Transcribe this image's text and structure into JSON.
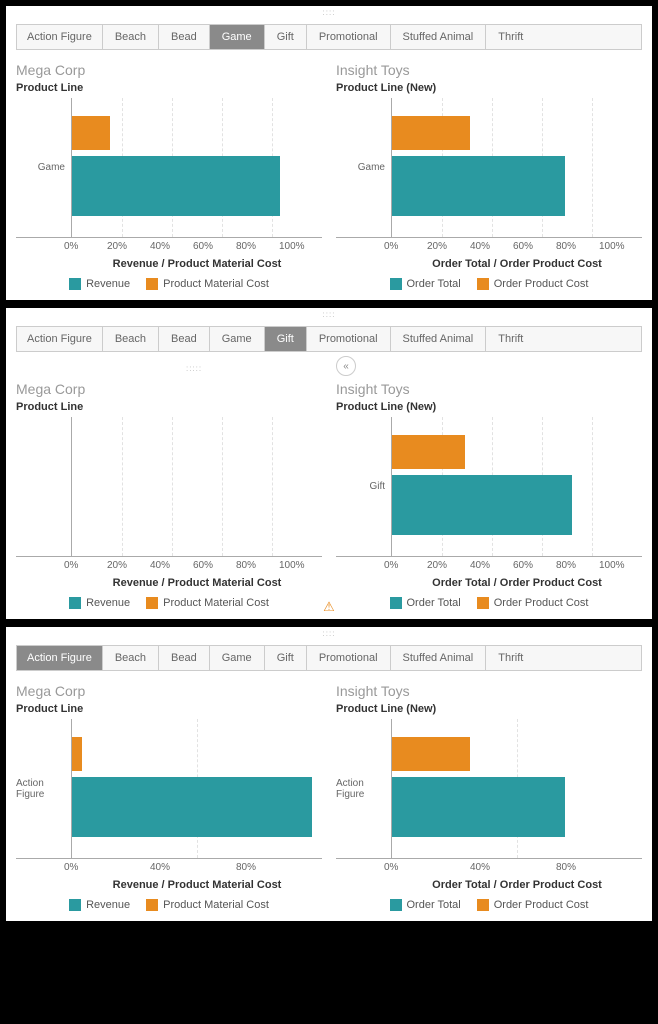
{
  "colors": {
    "teal": "#2a9aa0",
    "orange": "#e88b1f"
  },
  "tabs": [
    "Action Figure",
    "Beach",
    "Bead",
    "Game",
    "Gift",
    "Promotional",
    "Stuffed Animal",
    "Thrift"
  ],
  "panels": [
    {
      "active_tab": "Game",
      "show_widget_handle": false,
      "show_collapse": false,
      "show_warning": false,
      "left": {
        "company": "Mega Corp",
        "y_axis_title": "Product Line",
        "category": "Game",
        "x_axis_title": "Revenue / Product Material Cost",
        "ticks": [
          "0%",
          "20%",
          "40%",
          "60%",
          "80%",
          "100%"
        ],
        "legend": [
          "Revenue",
          "Product Material Cost"
        ],
        "bar_orange_pct": 15,
        "bar_teal_pct": 83
      },
      "right": {
        "company": "Insight Toys",
        "y_axis_title": "Product Line (New)",
        "category": "Game",
        "x_axis_title": "Order Total / Order Product Cost",
        "ticks": [
          "0%",
          "20%",
          "40%",
          "60%",
          "80%",
          "100%"
        ],
        "legend": [
          "Order Total",
          "Order Product Cost"
        ],
        "bar_orange_pct": 31,
        "bar_teal_pct": 69
      }
    },
    {
      "active_tab": "Gift",
      "show_widget_handle": true,
      "show_collapse": true,
      "show_warning": true,
      "left": {
        "company": "Mega Corp",
        "y_axis_title": "Product Line",
        "category": "",
        "x_axis_title": "Revenue / Product Material Cost",
        "ticks": [
          "0%",
          "20%",
          "40%",
          "60%",
          "80%",
          "100%"
        ],
        "legend": [
          "Revenue",
          "Product Material Cost"
        ],
        "bar_orange_pct": 0,
        "bar_teal_pct": 0
      },
      "right": {
        "company": "Insight Toys",
        "y_axis_title": "Product Line (New)",
        "category": "Gift",
        "x_axis_title": "Order Total / Order Product Cost",
        "ticks": [
          "0%",
          "20%",
          "40%",
          "60%",
          "80%",
          "100%"
        ],
        "legend": [
          "Order Total",
          "Order Product Cost"
        ],
        "bar_orange_pct": 29,
        "bar_teal_pct": 72
      }
    },
    {
      "active_tab": "Action Figure",
      "show_widget_handle": false,
      "show_collapse": false,
      "show_warning": false,
      "left": {
        "company": "Mega Corp",
        "y_axis_title": "Product Line",
        "category": "Action Figure",
        "x_axis_title": "Revenue / Product Material Cost",
        "ticks": [
          "0%",
          "40%",
          "80%"
        ],
        "legend": [
          "Revenue",
          "Product Material Cost"
        ],
        "bar_orange_pct": 4,
        "bar_teal_pct": 96
      },
      "right": {
        "company": "Insight Toys",
        "y_axis_title": "Product Line (New)",
        "category": "Action Figure",
        "x_axis_title": "Order Total / Order Product Cost",
        "ticks": [
          "0%",
          "40%",
          "80%"
        ],
        "legend": [
          "Order Total",
          "Order Product Cost"
        ],
        "bar_orange_pct": 31,
        "bar_teal_pct": 69
      }
    }
  ],
  "chart_data": [
    {
      "panel": 0,
      "side": "left",
      "type": "bar",
      "orientation": "horizontal",
      "title": "Mega Corp",
      "ylabel": "Product Line",
      "xlabel": "Revenue / Product Material Cost",
      "xlim": [
        0,
        100
      ],
      "x_unit": "%",
      "categories": [
        "Game"
      ],
      "series": [
        {
          "name": "Product Material Cost",
          "values": [
            15
          ],
          "color": "#e88b1f"
        },
        {
          "name": "Revenue",
          "values": [
            83
          ],
          "color": "#2a9aa0"
        }
      ]
    },
    {
      "panel": 0,
      "side": "right",
      "type": "bar",
      "orientation": "horizontal",
      "title": "Insight Toys",
      "ylabel": "Product Line (New)",
      "xlabel": "Order Total / Order Product Cost",
      "xlim": [
        0,
        100
      ],
      "x_unit": "%",
      "categories": [
        "Game"
      ],
      "series": [
        {
          "name": "Order Product Cost",
          "values": [
            31
          ],
          "color": "#e88b1f"
        },
        {
          "name": "Order Total",
          "values": [
            69
          ],
          "color": "#2a9aa0"
        }
      ]
    },
    {
      "panel": 1,
      "side": "left",
      "type": "bar",
      "orientation": "horizontal",
      "title": "Mega Corp",
      "ylabel": "Product Line",
      "xlabel": "Revenue / Product Material Cost",
      "xlim": [
        0,
        100
      ],
      "x_unit": "%",
      "categories": [],
      "series": [
        {
          "name": "Product Material Cost",
          "values": [],
          "color": "#e88b1f"
        },
        {
          "name": "Revenue",
          "values": [],
          "color": "#2a9aa0"
        }
      ],
      "note": "no data for Gift in Mega Corp"
    },
    {
      "panel": 1,
      "side": "right",
      "type": "bar",
      "orientation": "horizontal",
      "title": "Insight Toys",
      "ylabel": "Product Line (New)",
      "xlabel": "Order Total / Order Product Cost",
      "xlim": [
        0,
        100
      ],
      "x_unit": "%",
      "categories": [
        "Gift"
      ],
      "series": [
        {
          "name": "Order Product Cost",
          "values": [
            29
          ],
          "color": "#e88b1f"
        },
        {
          "name": "Order Total",
          "values": [
            72
          ],
          "color": "#2a9aa0"
        }
      ]
    },
    {
      "panel": 2,
      "side": "left",
      "type": "bar",
      "orientation": "horizontal",
      "title": "Mega Corp",
      "ylabel": "Product Line",
      "xlabel": "Revenue / Product Material Cost",
      "xlim": [
        0,
        100
      ],
      "x_unit": "%",
      "categories": [
        "Action Figure"
      ],
      "series": [
        {
          "name": "Product Material Cost",
          "values": [
            4
          ],
          "color": "#e88b1f"
        },
        {
          "name": "Revenue",
          "values": [
            96
          ],
          "color": "#2a9aa0"
        }
      ]
    },
    {
      "panel": 2,
      "side": "right",
      "type": "bar",
      "orientation": "horizontal",
      "title": "Insight Toys",
      "ylabel": "Product Line (New)",
      "xlabel": "Order Total / Order Product Cost",
      "xlim": [
        0,
        100
      ],
      "x_unit": "%",
      "categories": [
        "Action Figure"
      ],
      "series": [
        {
          "name": "Order Product Cost",
          "values": [
            31
          ],
          "color": "#e88b1f"
        },
        {
          "name": "Order Total",
          "values": [
            69
          ],
          "color": "#2a9aa0"
        }
      ]
    }
  ]
}
